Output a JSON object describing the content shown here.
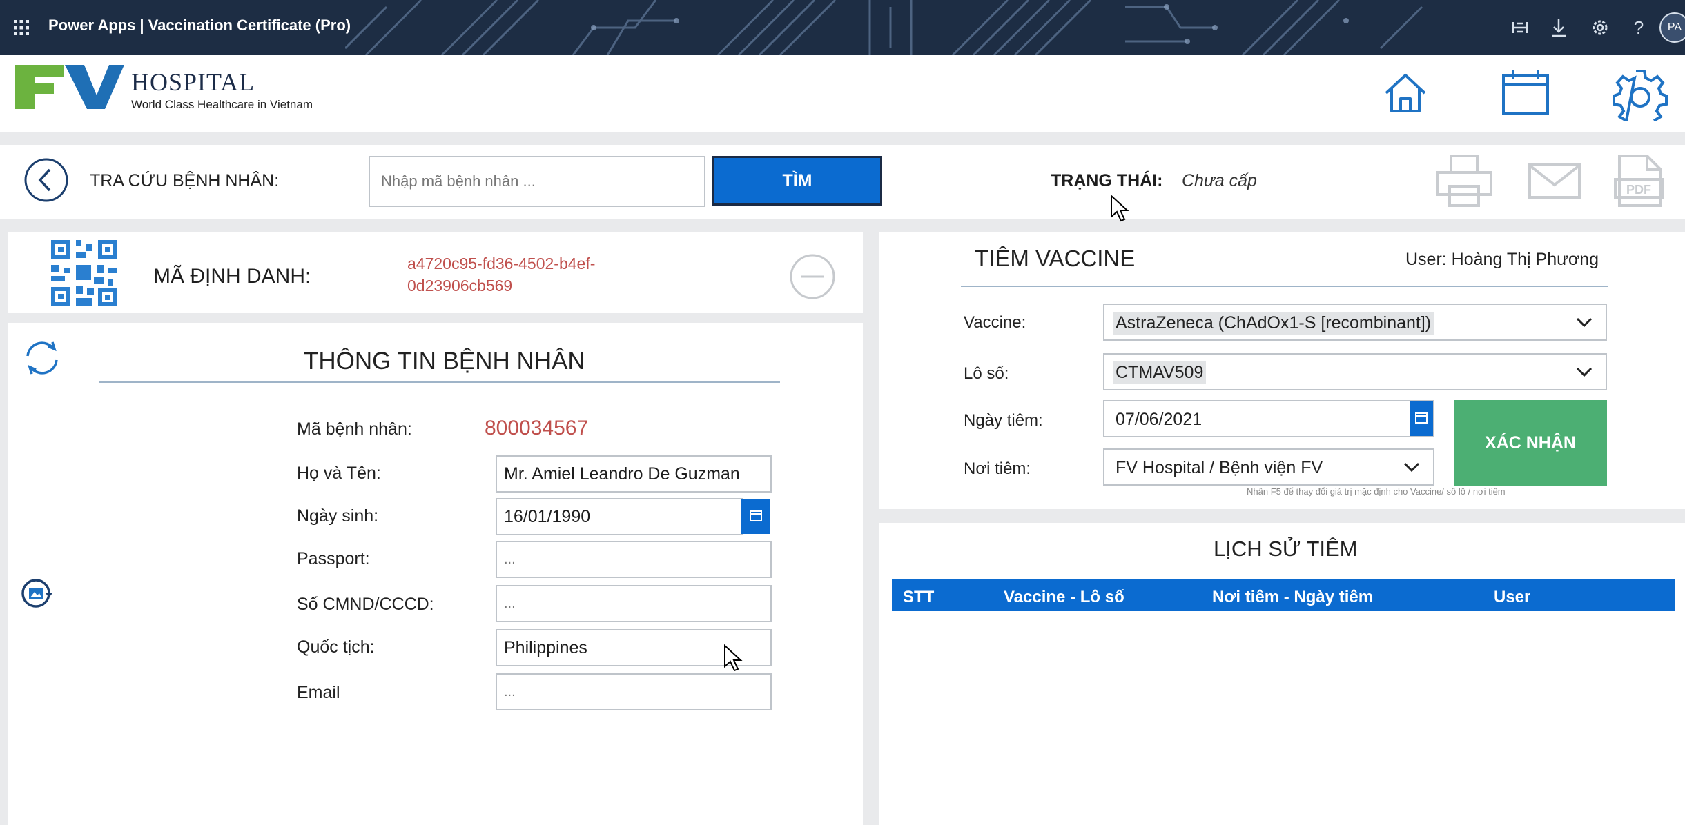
{
  "topbar": {
    "app_title": "Power Apps  |  Vaccination Certificate (Pro)",
    "avatar_initials": "PA",
    "icons": [
      "grid-icon",
      "fit-screen-icon",
      "download-icon",
      "settings-icon",
      "help-icon"
    ],
    "help_glyph": "?"
  },
  "header": {
    "logo_name": "HOSPITAL",
    "logo_tagline": "World Class Healthcare in Vietnam",
    "icons": [
      "home-icon",
      "calendar-icon",
      "settings-icon"
    ]
  },
  "search": {
    "label": "TRA CỨU BỆNH NHÂN:",
    "placeholder": "Nhập mã bệnh nhân ...",
    "button": "TÌM",
    "status_label": "TRẠNG THÁI:",
    "status_value": "Chưa cấp",
    "action_icons": [
      "print-icon",
      "mail-icon",
      "pdf-icon"
    ]
  },
  "identifier": {
    "label": "MÃ ĐỊNH DANH:",
    "value_line1": "a4720c95-fd36-4502-b4ef-",
    "value_line2": "0d23906cb569"
  },
  "patient": {
    "title": "THÔNG TIN BỆNH NHÂN",
    "fields": [
      {
        "label": "Mã bệnh nhân:",
        "value": "800034567"
      },
      {
        "label": "Họ và Tên:",
        "value": "Mr. Amiel Leandro De Guzman"
      },
      {
        "label": "Ngày sinh:",
        "value": "16/01/1990"
      },
      {
        "label": "Passport:",
        "value": "..."
      },
      {
        "label": "Số CMND/CCCD:",
        "value": "..."
      },
      {
        "label": "Quốc tịch:",
        "value": "Philippines"
      },
      {
        "label": "Email",
        "value": "..."
      }
    ]
  },
  "vaccine": {
    "title": "TIÊM VACCINE",
    "user": "User: Hoàng Thị Phương",
    "fields": [
      {
        "label": "Vaccine:",
        "value": "AstraZeneca (ChAdOx1-S [recombinant])"
      },
      {
        "label": "Lô số:",
        "value": "CTMAV509"
      },
      {
        "label": "Ngày tiêm:",
        "value": "07/06/2021"
      },
      {
        "label": "Nơi tiêm:",
        "value": "FV Hospital / Bệnh viện FV"
      }
    ],
    "confirm_button": "XÁC NHẬN",
    "hint": "Nhấn F5 để thay đổi giá trị mặc định cho Vaccine/ số lô / nơi tiêm"
  },
  "history": {
    "title": "LỊCH SỬ TIÊM",
    "columns": [
      "STT",
      "Vaccine - Lô số",
      "Nơi tiêm - Ngày tiêm",
      "User"
    ],
    "rows": []
  },
  "colors": {
    "accent_blue": "#0b6bd0",
    "confirm_green": "#4caf73",
    "id_red": "#c0504d",
    "logo_green": "#6cb33f",
    "logo_blue": "#1f6fb5",
    "topbar": "#1d2d44"
  }
}
